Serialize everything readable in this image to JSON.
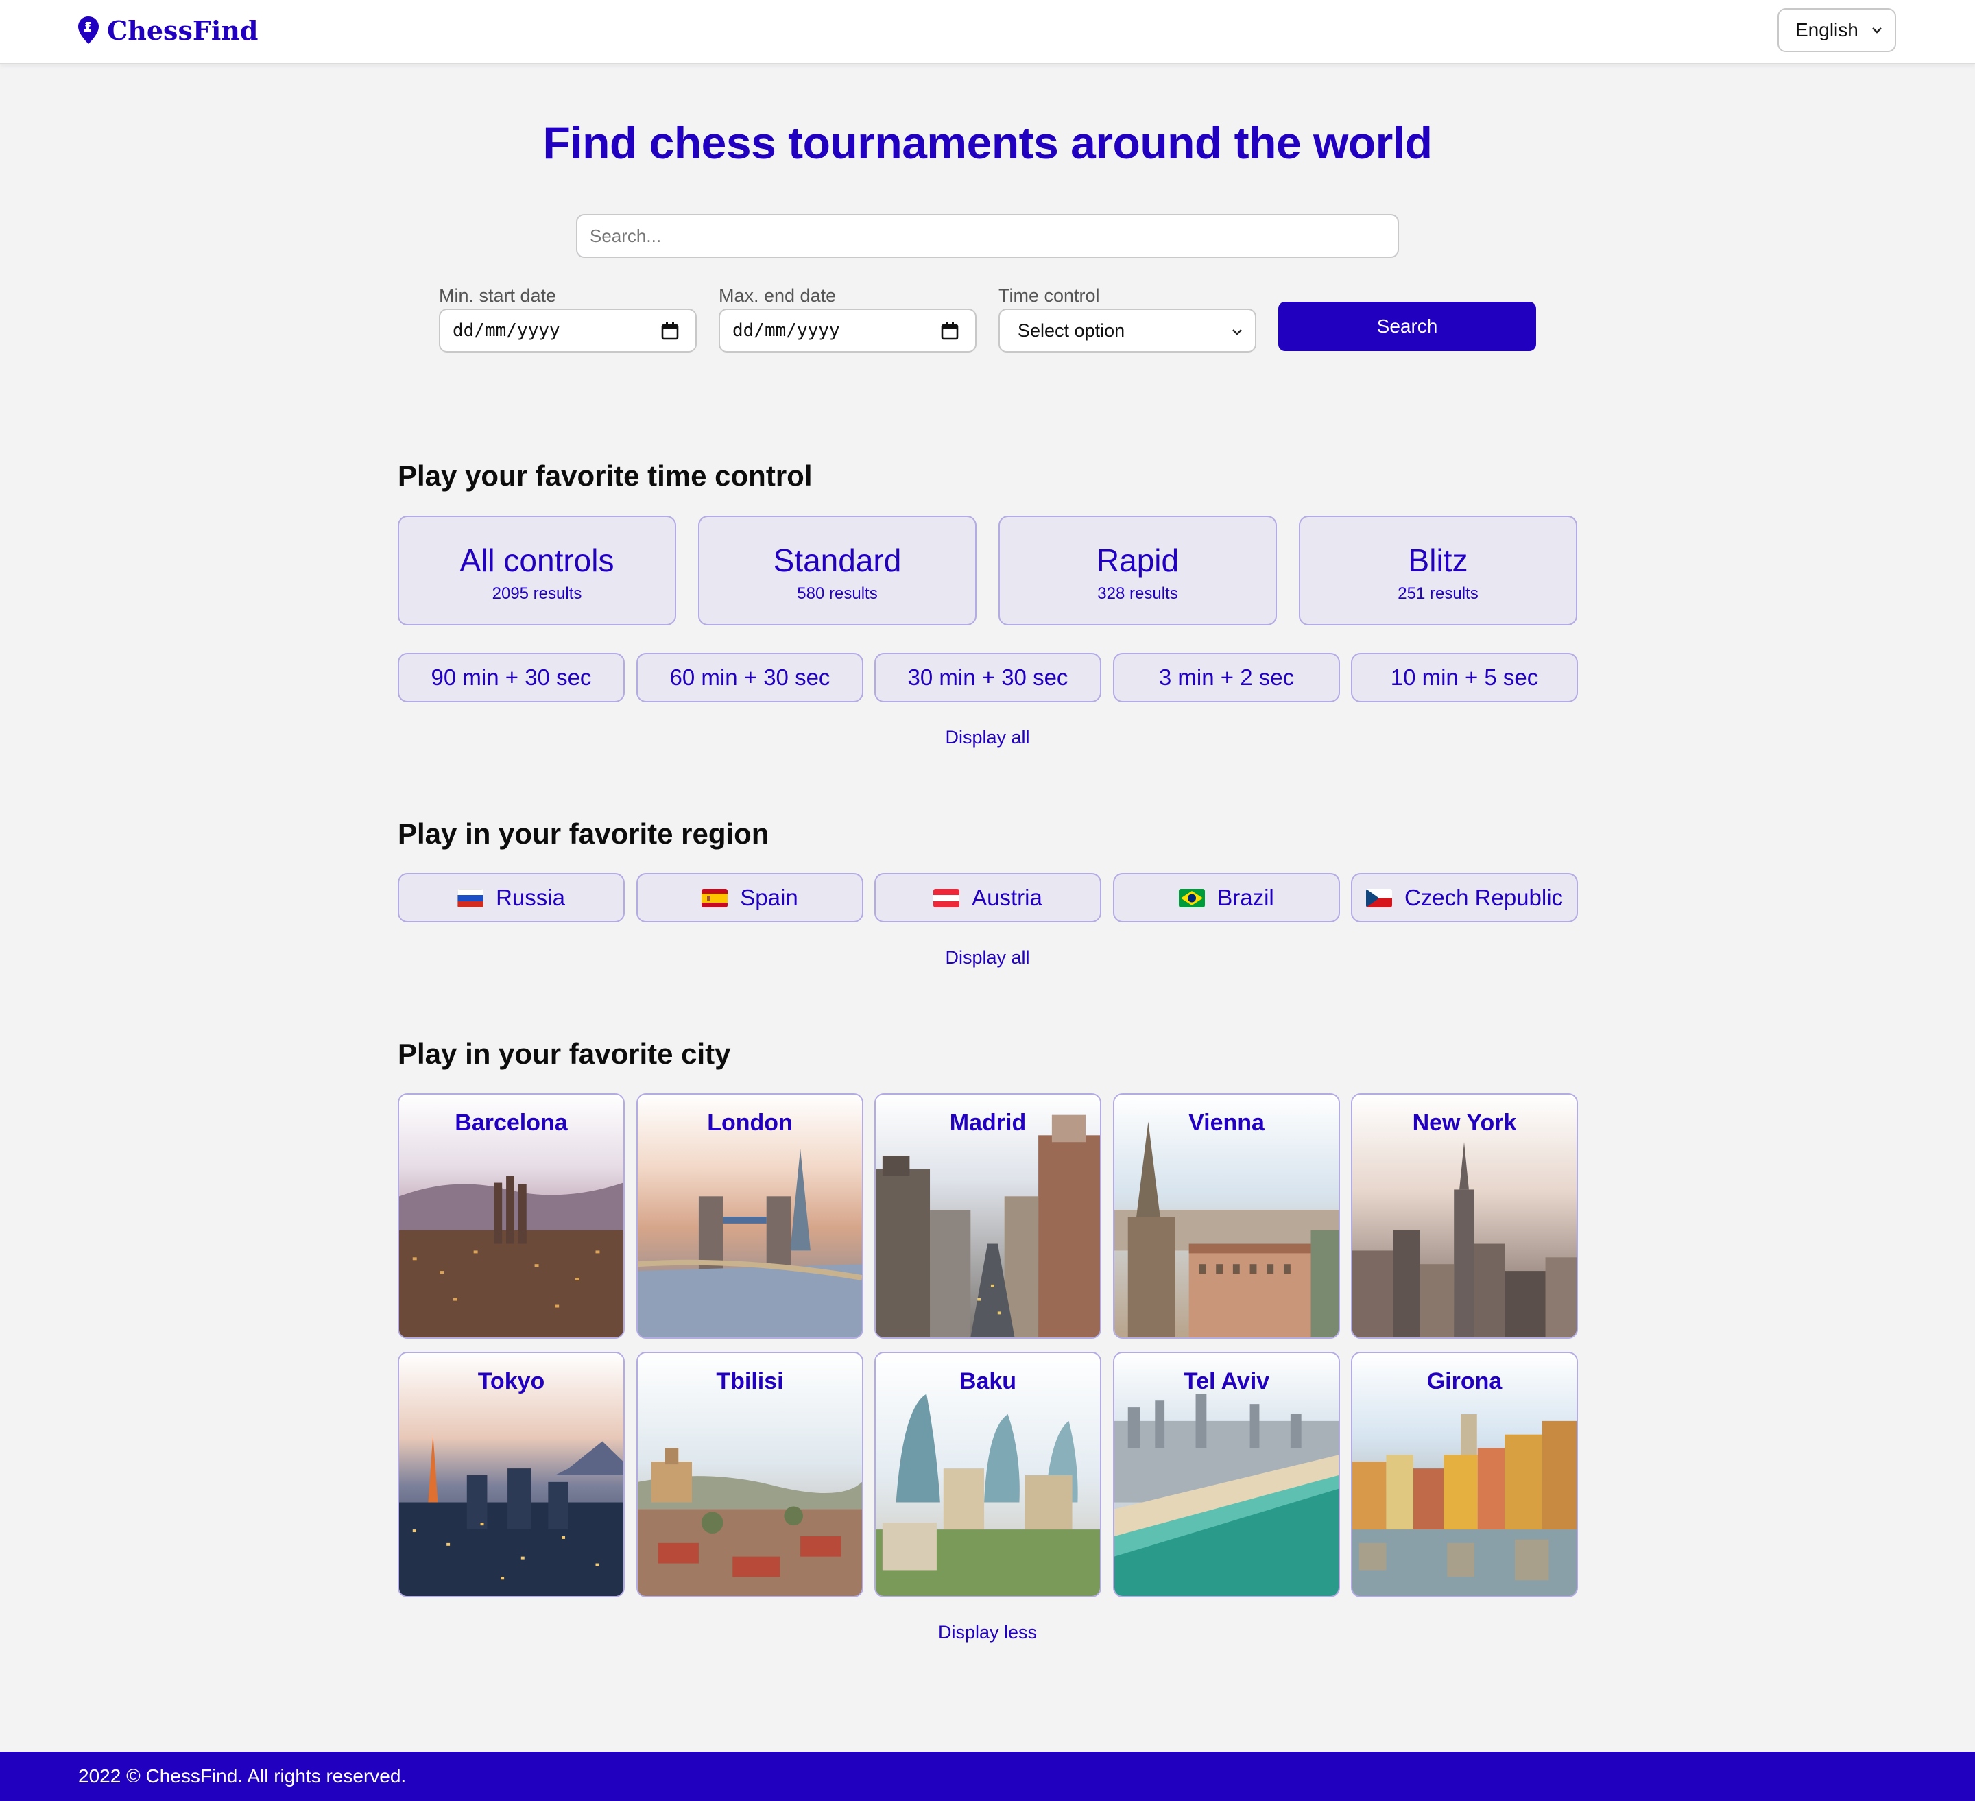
{
  "header": {
    "logo_text": "ChessFind",
    "language": "English"
  },
  "hero": {
    "title": "Find chess tournaments around the world",
    "search_placeholder": "Search...",
    "filters": {
      "min_start_label": "Min. start date",
      "min_start_value": "dd/mm/yyyy",
      "max_end_label": "Max. end date",
      "max_end_value": "dd/mm/yyyy",
      "time_control_label": "Time control",
      "time_control_value": "Select option"
    },
    "search_button": "Search"
  },
  "time_controls": {
    "title": "Play your favorite time control",
    "categories": [
      {
        "label": "All controls",
        "results": "2095 results"
      },
      {
        "label": "Standard",
        "results": "580 results"
      },
      {
        "label": "Rapid",
        "results": "328 results"
      },
      {
        "label": "Blitz",
        "results": "251 results"
      }
    ],
    "presets": [
      "90 min + 30 sec",
      "60 min + 30 sec",
      "30 min + 30 sec",
      "3 min + 2 sec",
      "10 min + 5 sec"
    ],
    "display_all": "Display all"
  },
  "regions": {
    "title": "Play in your favorite region",
    "items": [
      {
        "label": "Russia",
        "flag": "flag-russia-icon"
      },
      {
        "label": "Spain",
        "flag": "flag-spain-icon"
      },
      {
        "label": "Austria",
        "flag": "flag-austria-icon"
      },
      {
        "label": "Brazil",
        "flag": "flag-brazil-icon"
      },
      {
        "label": "Czech Republic",
        "flag": "flag-czech-icon"
      }
    ],
    "display_all": "Display all"
  },
  "cities": {
    "title": "Play in your favorite city",
    "items": [
      "Barcelona",
      "London",
      "Madrid",
      "Vienna",
      "New York",
      "Tokyo",
      "Tbilisi",
      "Baku",
      "Tel Aviv",
      "Girona"
    ],
    "display_less": "Display less"
  },
  "footer": {
    "text": "2022 © ChessFind. All rights reserved."
  },
  "colors": {
    "accent": "#2200c0",
    "card_bg": "#e9e7f1",
    "card_border": "#b3abe3",
    "page_bg": "#f3f3f4"
  }
}
